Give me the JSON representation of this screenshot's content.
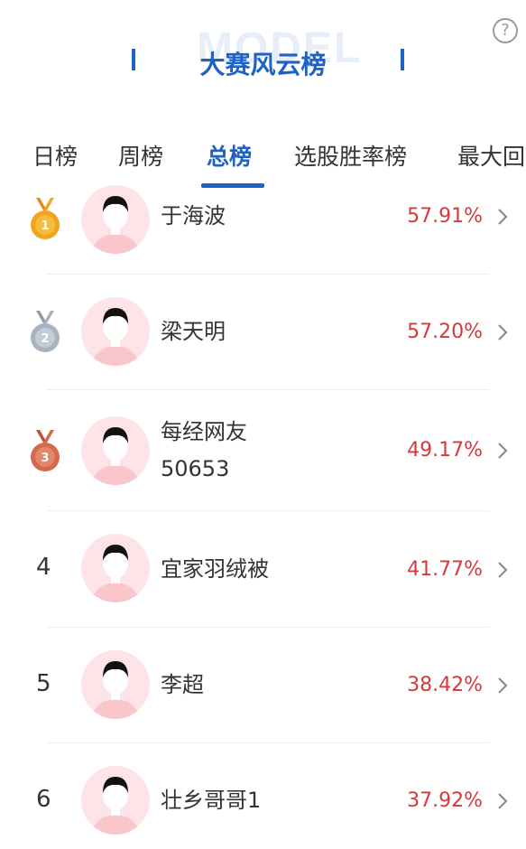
{
  "header": {
    "title": "大赛风云榜",
    "watermark": "MODEL",
    "help_symbol": "?"
  },
  "tabs": [
    {
      "label": "日榜",
      "active": false
    },
    {
      "label": "周榜",
      "active": false
    },
    {
      "label": "总榜",
      "active": true
    },
    {
      "label": "选股胜率榜",
      "active": false
    },
    {
      "label": "最大回",
      "active": false
    }
  ],
  "ranking": [
    {
      "rank": "1",
      "medal": "gold",
      "name_line1": "于海波",
      "name_line2": "",
      "percent": "57.91%"
    },
    {
      "rank": "2",
      "medal": "silver",
      "name_line1": "梁天明",
      "name_line2": "",
      "percent": "57.20%"
    },
    {
      "rank": "3",
      "medal": "bronze",
      "name_line1": "每经网友",
      "name_line2": "50653",
      "percent": "49.17%"
    },
    {
      "rank": "4",
      "medal": "",
      "name_line1": "宜家羽绒被",
      "name_line2": "",
      "percent": "41.77%"
    },
    {
      "rank": "5",
      "medal": "",
      "name_line1": "李超",
      "name_line2": "",
      "percent": "38.42%"
    },
    {
      "rank": "6",
      "medal": "",
      "name_line1": "壮乡哥哥1",
      "name_line2": "",
      "percent": "37.92%"
    }
  ],
  "colors": {
    "brand": "#1d62c4",
    "percent": "#d6393c",
    "gold": "#f0a51e",
    "silver": "#a9b3bd",
    "bronze": "#d46a4c",
    "avatar_bg": "#fde4e6"
  }
}
